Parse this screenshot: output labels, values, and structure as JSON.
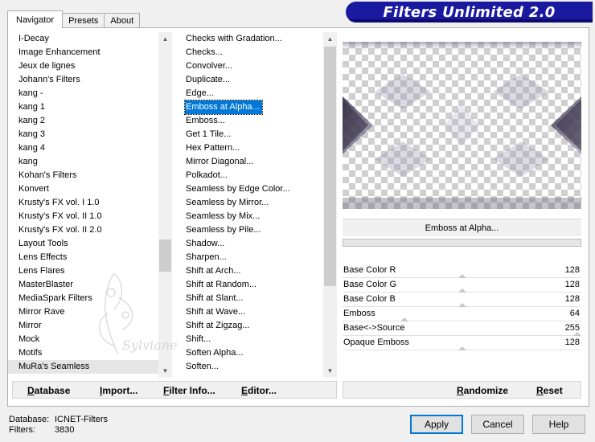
{
  "window": {
    "title": "Filters Unlimited 2.0"
  },
  "tabs": [
    {
      "label": "Navigator"
    },
    {
      "label": "Presets"
    },
    {
      "label": "About"
    }
  ],
  "categories": {
    "items": [
      "I-Decay",
      "Image Enhancement",
      "Jeux de lignes",
      "Johann's Filters",
      "kang -",
      "kang 1",
      "kang 2",
      "kang 3",
      "kang 4",
      "kang",
      "Kohan's Filters",
      "Konvert",
      "Krusty's FX vol. I 1.0",
      "Krusty's FX vol. II 1.0",
      "Krusty's FX vol. II 2.0",
      "Layout Tools",
      "Lens Effects",
      "Lens Flares",
      "MasterBlaster",
      "MediaSpark Filters",
      "Mirror Rave",
      "Mirror",
      "Mock",
      "Motifs",
      "MuRa's Seamless"
    ],
    "selected": "MuRa's Seamless"
  },
  "filters": {
    "items": [
      "Checks with Gradation...",
      "Checks...",
      "Convolver...",
      "Duplicate...",
      "Edge...",
      "Emboss at Alpha...",
      "Emboss...",
      "Get 1 Tile...",
      "Hex Pattern...",
      "Mirror Diagonal...",
      "Polkadot...",
      "Seamless by Edge Color...",
      "Seamless by Mirror...",
      "Seamless by Mix...",
      "Seamless by Pile...",
      "Shadow...",
      "Sharpen...",
      "Shift at Arch...",
      "Shift at Random...",
      "Shift at Slant...",
      "Shift at Wave...",
      "Shift at Zigzag...",
      "Shift...",
      "Soften Alpha...",
      "Soften..."
    ],
    "selected": "Emboss at Alpha..."
  },
  "preview": {
    "filter_name": "Emboss at Alpha..."
  },
  "params": [
    {
      "label": "Base Color R",
      "value": "128",
      "level": 0.502
    },
    {
      "label": "Base Color G",
      "value": "128",
      "level": 0.502
    },
    {
      "label": "Base Color B",
      "value": "128",
      "level": 0.502
    },
    {
      "label": "Emboss",
      "value": "64",
      "level": 0.251
    },
    {
      "label": "Base<->Source",
      "value": "255",
      "level": 1.0
    },
    {
      "label": "Opaque Emboss",
      "value": "128",
      "level": 0.502
    }
  ],
  "toolbar_left": [
    {
      "label": "Database",
      "ul": "D",
      "rest": "atabase"
    },
    {
      "label": "Import...",
      "ul": "I",
      "rest": "mport..."
    },
    {
      "label": "Filter Info...",
      "ul": "F",
      "rest": "ilter Info..."
    },
    {
      "label": "Editor...",
      "ul": "E",
      "rest": "ditor..."
    }
  ],
  "toolbar_right": [
    {
      "label": "Randomize",
      "ul": "R",
      "rest": "andomize"
    },
    {
      "label": "Reset",
      "ul": "R",
      "rest": "eset"
    }
  ],
  "footer": {
    "database_label": "Database:",
    "database_value": "ICNET-Filters",
    "filters_label": "Filters:",
    "filters_value": "3830"
  },
  "buttons": {
    "apply": "Apply",
    "cancel": "Cancel",
    "help": "Help"
  },
  "watermark": "Sylviane",
  "colors": {
    "accent": "#0078d7",
    "banner": "#1a1aa0"
  }
}
